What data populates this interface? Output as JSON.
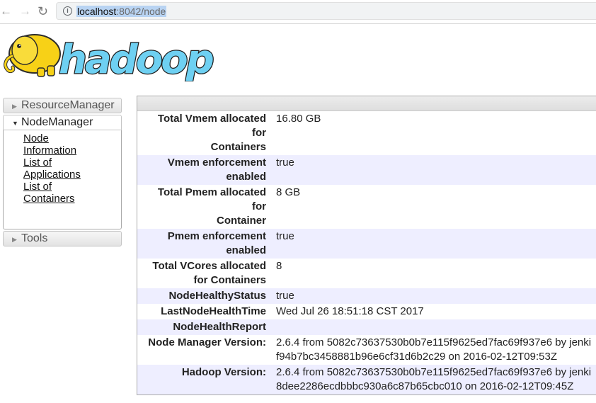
{
  "browser": {
    "back_icon": "arrow-left-icon",
    "forward_icon": "arrow-right-icon",
    "reload_icon": "reload-icon",
    "info_icon": "info-icon",
    "url_host": "localhost",
    "url_rest": ":8042/node"
  },
  "logo": {
    "text": "hadoop"
  },
  "sidebar": {
    "resource_manager": "ResourceManager",
    "node_manager": "NodeManager",
    "links": [
      {
        "label": "Node Information"
      },
      {
        "label": "List of Applications"
      },
      {
        "label": "List of Containers"
      }
    ],
    "tools": "Tools"
  },
  "info": {
    "rows": [
      {
        "key": "Total Vmem allocated for Containers",
        "value": "16.80 GB"
      },
      {
        "key": "Vmem enforcement enabled",
        "value": "true"
      },
      {
        "key": "Total Pmem allocated for Container",
        "value": "8 GB"
      },
      {
        "key": "Pmem enforcement enabled",
        "value": "true"
      },
      {
        "key": "Total VCores allocated for Containers",
        "value": "8"
      },
      {
        "key": "NodeHealthyStatus",
        "value": "true"
      },
      {
        "key": "LastNodeHealthTime",
        "value": "Wed Jul 26 18:51:18 CST 2017"
      },
      {
        "key": "NodeHealthReport",
        "value": ""
      },
      {
        "key": "Node Manager Version:",
        "value": "2.6.4 from 5082c73637530b0b7e115f9625ed7fac69f937e6 by jenki",
        "value2": "f94b7bc3458881b96e6cf31d6b2c29 on 2016-02-12T09:53Z"
      },
      {
        "key": "Hadoop Version:",
        "value": "2.6.4 from 5082c73637530b0b7e115f9625ed7fac69f937e6 by jenki",
        "value2": "8dee2286ecdbbbc930a6c87b65cbc010 on 2016-02-12T09:45Z"
      }
    ]
  }
}
